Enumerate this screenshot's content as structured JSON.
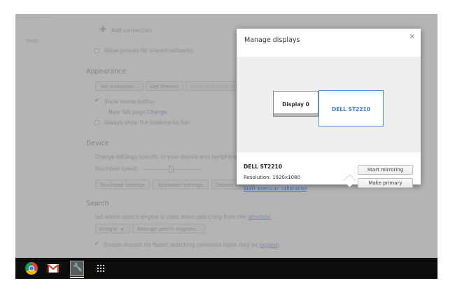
{
  "settings": {
    "nav": {
      "help": "Help"
    },
    "add_connection": "Add connection",
    "allow_proxies": "Allow proxies for shared networks",
    "appearance": {
      "heading": "Appearance",
      "wallpaper_btn": "Set wallpaper...",
      "themes_btn": "Get themes",
      "reset_btn": "Reset to default theme",
      "show_home": "Show Home button",
      "new_tab": "New Tab page",
      "change_link": "Change",
      "bookmarks_bar": "Always show the bookmarks bar"
    },
    "device": {
      "heading": "Device",
      "description": "Change settings specific to your device and peripherals.",
      "touchpad_speed": "Touchpad speed:",
      "touchpad_btn": "Touchpad settings",
      "keyboard_btn": "Keyboard settings",
      "display_btn": "Display settings"
    },
    "search": {
      "heading": "Search",
      "description": "Set which search engine is used when searching from the",
      "omnibox_link": "omnibox",
      "engine": "Google",
      "manage_btn": "Manage search engines...",
      "instant": "Enable Instant for faster searching (omnibox input may be",
      "logged_link": "logged"
    }
  },
  "dialog": {
    "title": "Manage displays",
    "close": "×",
    "displays": [
      {
        "label": "Display 0"
      },
      {
        "label": "DELL ST2210"
      }
    ],
    "selected": {
      "name": "DELL ST2210",
      "resolution": "Resolution: 1920x1080",
      "overscan_link": "Start overscan calibration"
    },
    "mirror_btn": "Start mirroring",
    "primary_btn": "Make primary"
  },
  "shelf": {
    "icons": [
      "chrome-icon",
      "gmail-icon",
      "settings-app-icon",
      "app-launcher-icon"
    ]
  }
}
